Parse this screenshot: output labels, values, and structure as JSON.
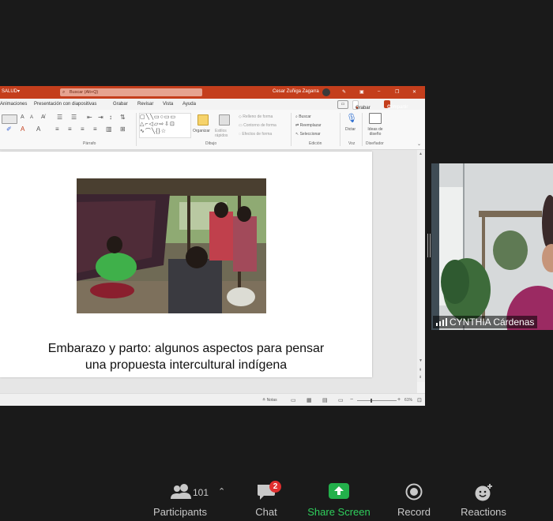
{
  "powerpoint": {
    "title_left": "SALUD",
    "search_placeholder": "Buscar (Alt+Q)",
    "user_name": "Cesar Zuñiga Zagarra",
    "menu": [
      "Animaciones",
      "Presentación con diapositivas",
      "Grabar",
      "Revisar",
      "Vista",
      "Ayuda"
    ],
    "grabar_button": "Grabar",
    "compartir_button": "Compartir",
    "ribbon": {
      "parrafo_label": "Párrafo",
      "dibujo_label": "Dibujo",
      "edicion_label": "Edición",
      "voz_label": "Voz",
      "disenador_label": "Diseñador",
      "organizar": "Organizar",
      "estilos_rapidos": "Estilos rápidos",
      "relleno_forma": "Relleno de forma",
      "contorno_forma": "Contorno de forma",
      "efectos_forma": "Efectos de forma",
      "buscar": "Buscar",
      "reemplazar": "Reemplazar",
      "seleccionar": "Seleccionar",
      "dictar": "Dictar",
      "ideas_diseno": "Ideas de diseño"
    },
    "slide_title_line1": "Embarazo y parto: algunos aspectos para pensar",
    "slide_title_line2": "una propuesta intercultural indígena",
    "status": {
      "notes": "Notas",
      "zoom": "61%"
    }
  },
  "participant": {
    "name": "CYNTHIA Cárdenas"
  },
  "toolbar": {
    "participants_label": "Participants",
    "participants_count": "101",
    "chat_label": "Chat",
    "chat_badge": "2",
    "share_label": "Share Screen",
    "record_label": "Record",
    "reactions_label": "Reactions"
  },
  "colors": {
    "ppt_accent": "#c43e1c",
    "share_green": "#23b04b",
    "badge_red": "#e02f2f"
  }
}
